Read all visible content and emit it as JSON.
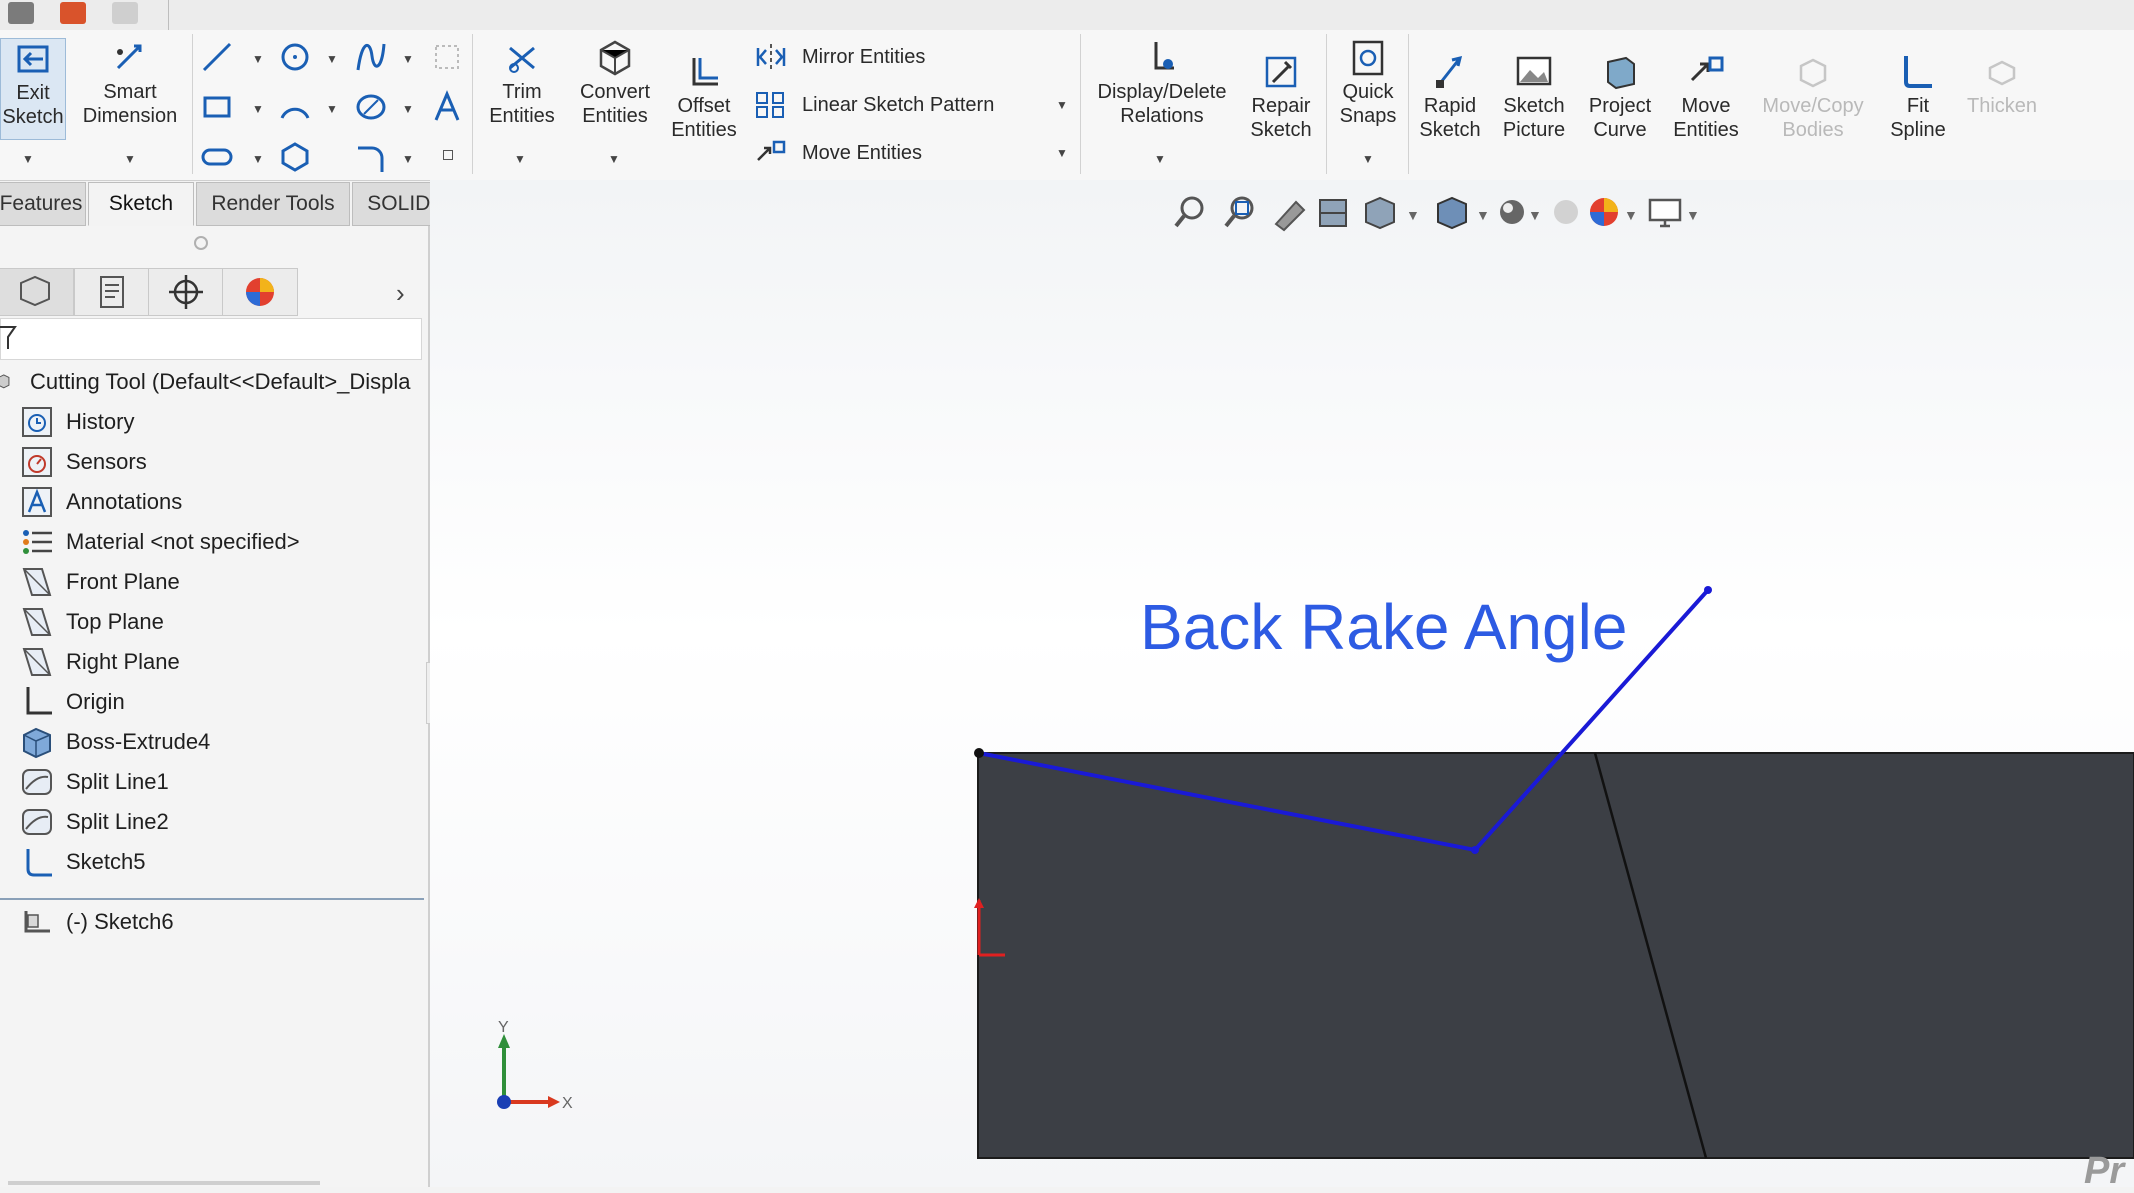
{
  "toolbar": {
    "exit_sketch": "Exit\nSketch",
    "smart_dimension": "Smart\nDimension",
    "trim_entities": "Trim\nEntities",
    "convert_entities": "Convert\nEntities",
    "offset_entities": "Offset\nEntities",
    "mirror_entities": "Mirror Entities",
    "linear_sketch_pattern": "Linear Sketch Pattern",
    "move_entities_small": "Move Entities",
    "display_delete_relations": "Display/Delete\nRelations",
    "repair_sketch": "Repair\nSketch",
    "quick_snaps": "Quick\nSnaps",
    "rapid_sketch": "Rapid\nSketch",
    "sketch_picture": "Sketch\nPicture",
    "project_curve": "Project\nCurve",
    "move_entities": "Move\nEntities",
    "move_copy_bodies": "Move/Copy\nBodies",
    "fit_spline": "Fit\nSpline",
    "thicken": "Thicken"
  },
  "tabs": [
    "Features",
    "Sketch",
    "Render Tools",
    "SOLIDWORKS Add-Ins"
  ],
  "active_tab": "Sketch",
  "tree": {
    "root": "Cutting Tool  (Default<<Default>_Displa",
    "items": [
      {
        "label": "History",
        "icon": "history-icon"
      },
      {
        "label": "Sensors",
        "icon": "sensors-icon"
      },
      {
        "label": "Annotations",
        "icon": "annotations-icon"
      },
      {
        "label": "Material <not specified>",
        "icon": "material-icon"
      },
      {
        "label": "Front Plane",
        "icon": "plane-icon"
      },
      {
        "label": "Top Plane",
        "icon": "plane-icon"
      },
      {
        "label": "Right Plane",
        "icon": "plane-icon"
      },
      {
        "label": "Origin",
        "icon": "origin-icon"
      },
      {
        "label": "Boss-Extrude4",
        "icon": "extrude-icon"
      },
      {
        "label": "Split Line1",
        "icon": "split-line-icon"
      },
      {
        "label": "Split Line2",
        "icon": "split-line-icon"
      },
      {
        "label": "Sketch5",
        "icon": "sketch-icon"
      },
      {
        "label": "(-) Sketch6",
        "icon": "sketch-edit-icon"
      }
    ]
  },
  "viewport": {
    "annotation": "Back Rake Angle",
    "triad_y": "Y",
    "triad_x": "X",
    "watermark": "Pr"
  },
  "colors": {
    "sketch_line": "#1a1ad6",
    "annotation": "#2d5be3",
    "part_face": "#3c3f45",
    "accent": "#1a5fb4"
  }
}
